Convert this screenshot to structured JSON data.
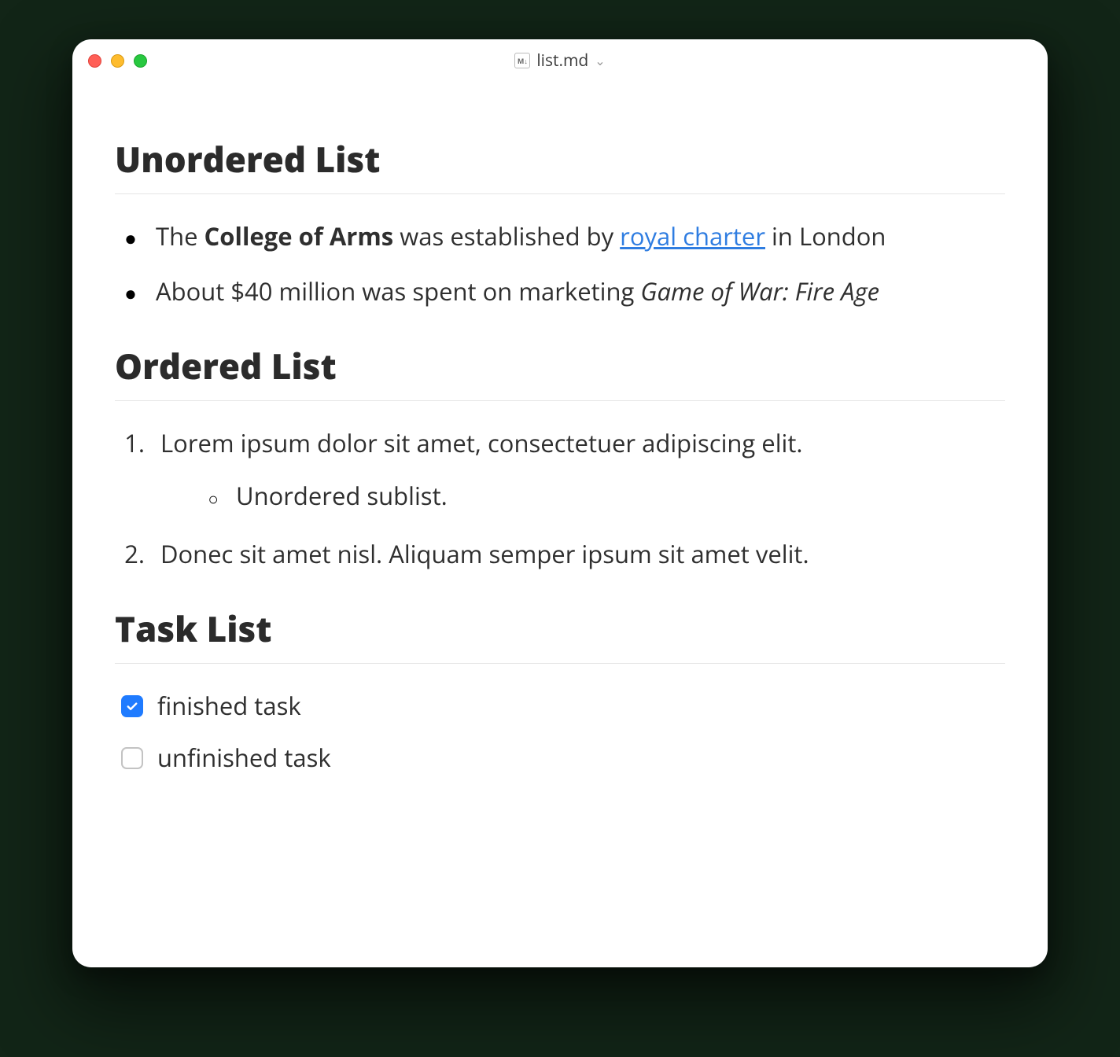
{
  "window": {
    "filename": "list.md",
    "doc_icon_label": "M↓"
  },
  "sections": {
    "unordered_title": "Unordered List",
    "unordered_items": {
      "i0": {
        "pre": "The ",
        "bold": "College of Arms",
        "mid": " was established by ",
        "link": "royal charter",
        "post": " in London"
      },
      "i1": {
        "pre": "About $40 million was spent on marketing ",
        "italic": "Game of War: Fire Age"
      }
    },
    "ordered_title": "Ordered List",
    "ordered_items": {
      "o0": {
        "marker": "1.",
        "text": "Lorem ipsum dolor sit amet, consectetuer adipiscing elit.",
        "sub0": "Unordered sublist."
      },
      "o1": {
        "marker": "2.",
        "text": "Donec sit amet nisl. Aliquam semper ipsum sit amet velit."
      }
    },
    "task_title": "Task List",
    "tasks": {
      "t0": {
        "label": "finished task",
        "checked": true
      },
      "t1": {
        "label": "unfinished task",
        "checked": false
      }
    }
  }
}
